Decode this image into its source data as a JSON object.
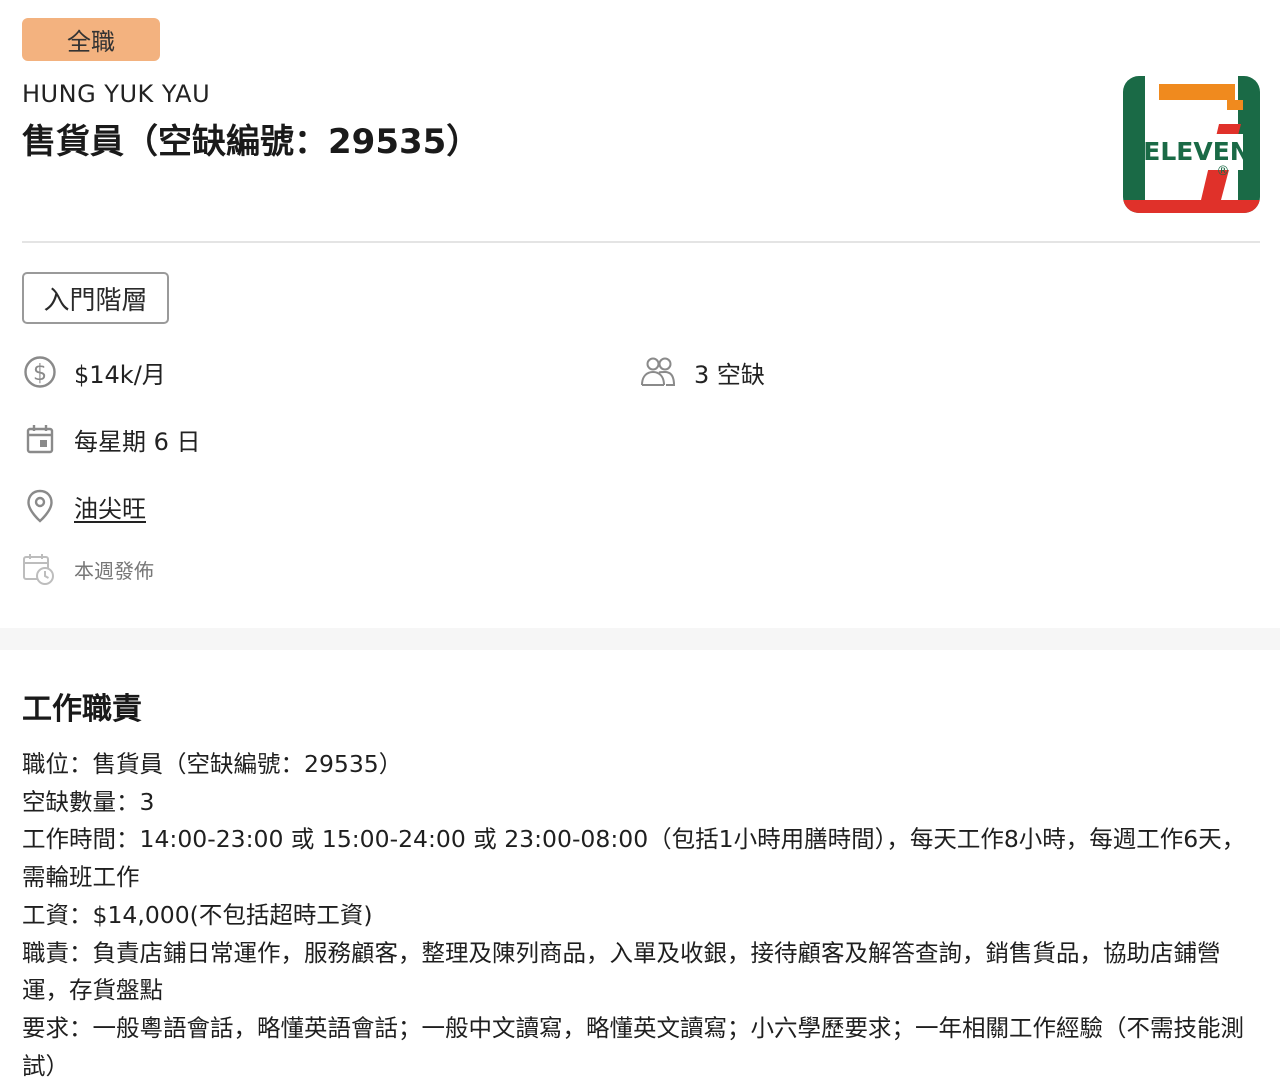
{
  "job": {
    "type_badge": "全職",
    "company": "HUNG YUK YAU",
    "title": "售貨員（空缺編號：29535）",
    "level": "入門階層",
    "salary": "$14k/月",
    "vacancies": "3 空缺",
    "schedule": "每星期 6 日",
    "location": "油尖旺",
    "posted": "本週發佈"
  },
  "logo": {
    "text": "ELEVEN",
    "registered_mark": "®",
    "colors": {
      "green": "#1a6a46",
      "orange": "#f08a1e",
      "red": "#e0312a"
    }
  },
  "section": {
    "title": "工作職責"
  },
  "description": [
    "職位：售貨員（空缺編號：29535）",
    "空缺數量：3",
    "工作時間：14:00-23:00 或 15:00-24:00 或 23:00-08:00（包括1小時用膳時間），每天工作8小時，每週工作6天，需輪班工作",
    "工資：$14,000(不包括超時工資)",
    "職責：負責店鋪日常運作，服務顧客，整理及陳列商品，入單及收銀，接待顧客及解答查詢，銷售貨品，協助店鋪營運，存貨盤點",
    "要求：一般粵語會話，略懂英語會話；一般中文讀寫，略懂英文讀寫；小六學歷要求；一年相關工作經驗（不需技能測試）"
  ],
  "colors": {
    "badge": "#f3b27f",
    "link": "#3d55c9",
    "icon": "#8a8a8a"
  }
}
